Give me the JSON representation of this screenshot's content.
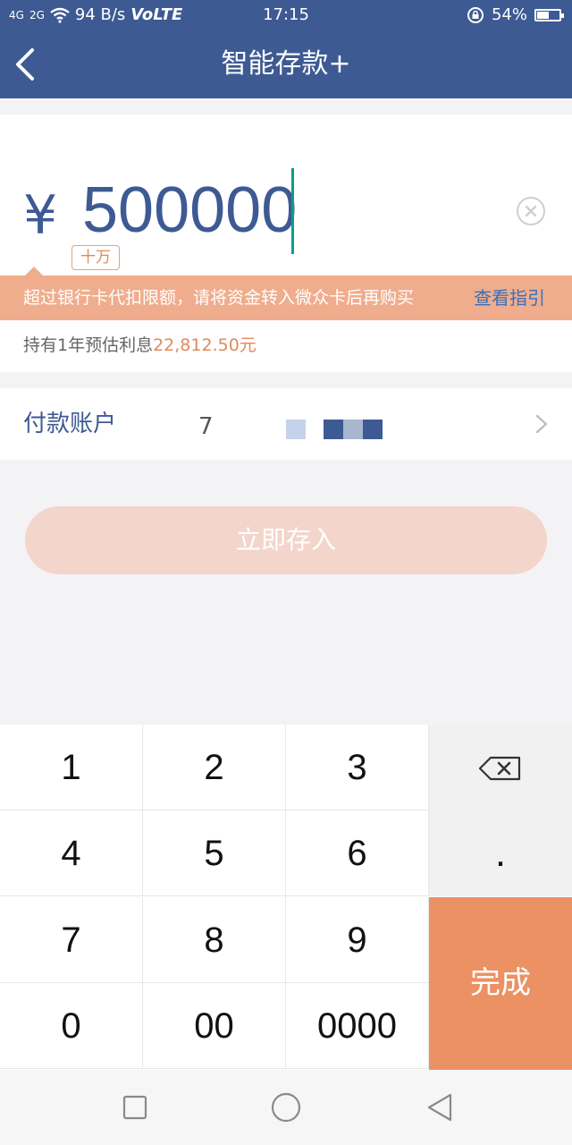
{
  "status_bar": {
    "signal_1": "4G",
    "signal_2": "2G",
    "speed": "94 B/s",
    "volte": "VoLTE",
    "time": "17:15",
    "battery": "54%",
    "battery_level": 0.54
  },
  "header": {
    "title": "智能存款+"
  },
  "amount": {
    "currency": "¥",
    "value": "500000",
    "unit_hint": "十万"
  },
  "warning": {
    "text": "超过银行卡代扣限额，请将资金转入微众卡后再购买",
    "link": "查看指引"
  },
  "interest": {
    "label": "持有1年预估利息",
    "value": "22,812.50元"
  },
  "account": {
    "label": "付款账户",
    "masked": "7"
  },
  "submit": {
    "label": "立即存入"
  },
  "keypad": {
    "keys": [
      "1",
      "2",
      "3",
      "4",
      "5",
      "6",
      "7",
      "8",
      "9",
      "0",
      "00",
      "0000"
    ],
    "dot": ".",
    "done": "完成"
  },
  "colors": {
    "brand": "#3d5a93",
    "warning_bg": "#f0ad8d",
    "accent": "#ec9163",
    "link": "#3a6fb8"
  }
}
